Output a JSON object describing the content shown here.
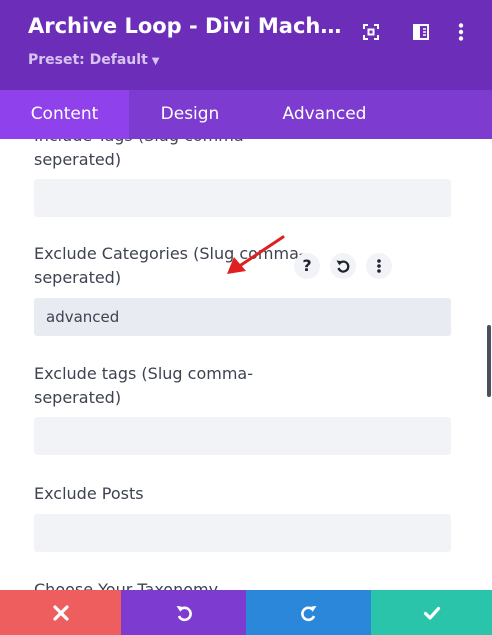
{
  "header": {
    "title": "Archive Loop - Divi Machin…",
    "preset_label": "Preset: Default",
    "icons": [
      "expand-icon",
      "sidebar-toggle-icon",
      "more-vertical-icon"
    ]
  },
  "tabs": [
    {
      "label": "Content",
      "active": true
    },
    {
      "label": "Design",
      "active": false
    },
    {
      "label": "Advanced",
      "active": false
    }
  ],
  "fields": {
    "include_tags": {
      "label": "Include Tags (Slug comma-seperated)",
      "value": ""
    },
    "exclude_categories": {
      "label": "Exclude Categories (Slug comma-seperated)",
      "value": "advanced"
    },
    "exclude_tags": {
      "label": "Exclude tags (Slug comma-seperated)",
      "value": ""
    },
    "exclude_posts": {
      "label": "Exclude Posts",
      "value": ""
    },
    "choose_taxonomy": {
      "label": "Choose Your Taxonomy"
    }
  },
  "field_buttons": {
    "help": "?"
  },
  "colors": {
    "header": "#6c2eb9",
    "tab_bar": "#7d3bcf",
    "tab_active": "#8f42ec",
    "cancel": "#ef5e5e",
    "undo": "#7e3bd0",
    "redo": "#2b87da",
    "save": "#29c4a9",
    "arrow": "#e02020"
  },
  "footer": [
    "close-icon",
    "undo-icon",
    "redo-icon",
    "check-icon"
  ]
}
